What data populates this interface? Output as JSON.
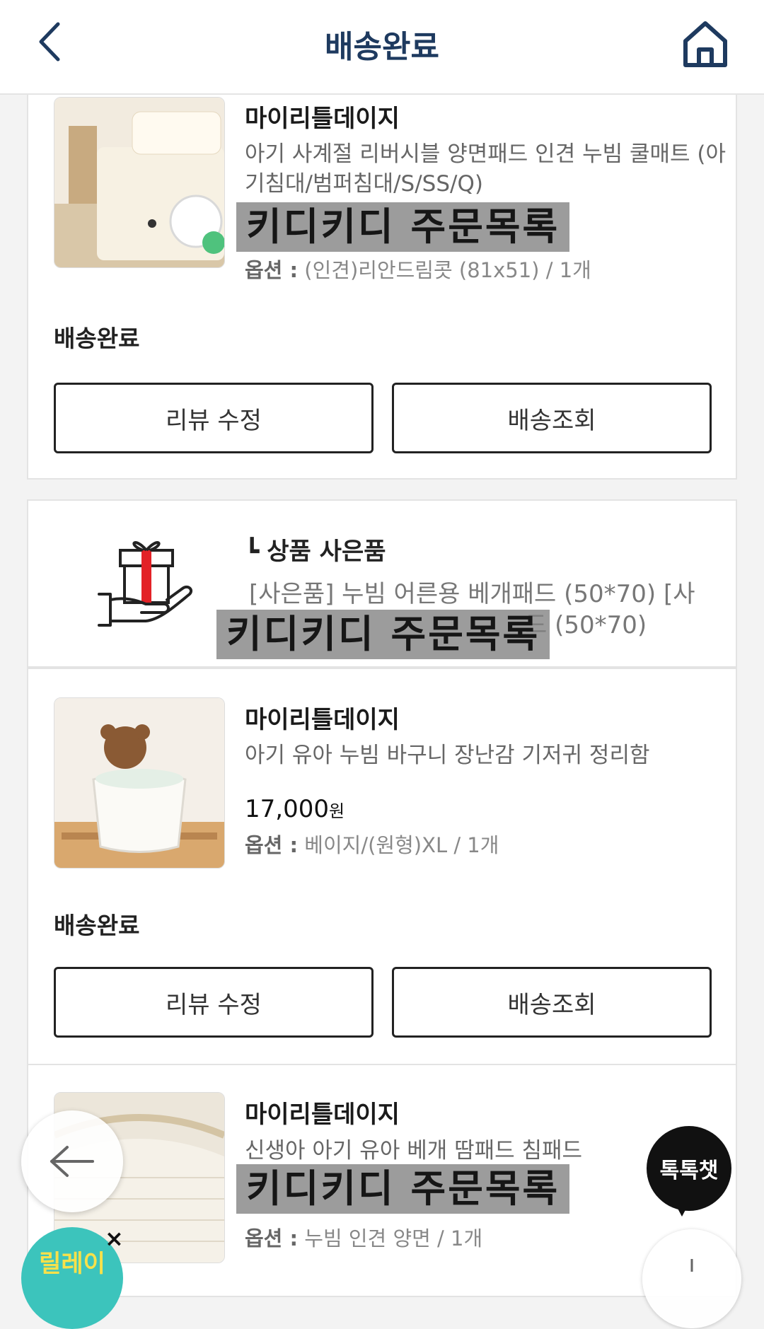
{
  "header": {
    "title": "배송완료",
    "back_icon": "chevron-left-icon",
    "home_icon": "home-icon"
  },
  "watermark": "키디키디 주문목록",
  "orders": [
    {
      "seller": "마이리틀데이지",
      "name": "아기 사계절 리버시블 양면패드 인견 누빔 쿨매트 (아기침대/범퍼침대/S/SS/Q)",
      "option_label": "옵션 :",
      "option_value": "(인견)리안드림콧 (81x51) / 1개",
      "status": "배송완료",
      "buttons": [
        "리뷰 수정",
        "배송조회"
      ]
    },
    {
      "seller": "마이리틀데이지",
      "name": "아기 유아 누빔 바구니 장난감 기저귀 정리함",
      "price": "17,000",
      "price_unit": "원",
      "option_label": "옵션 :",
      "option_value": "베이지/(원형)XL / 1개",
      "status": "배송완료",
      "buttons": [
        "리뷰 수정",
        "배송조회"
      ]
    },
    {
      "seller": "마이리틀데이지",
      "name": "신생아 아기 유아 베개 땀패드 침패드",
      "option_label": "옵션 :",
      "option_value": "누빔 인견 양면 / 1개"
    }
  ],
  "gift": {
    "tag": "상품 사은품",
    "desc_line1": "[사은품] 누빔 어른용 베개패드 (50*70) [사",
    "desc_line2": "드 (50*70)",
    "icon": "gift-hand-icon"
  },
  "floating": {
    "chat_label": "톡톡챗",
    "relay_label": "릴레이",
    "relay_close": "×"
  },
  "colors": {
    "title": "#1e3a5f",
    "relay_bg": "#3cc4bc",
    "relay_text": "#f8e14a"
  }
}
